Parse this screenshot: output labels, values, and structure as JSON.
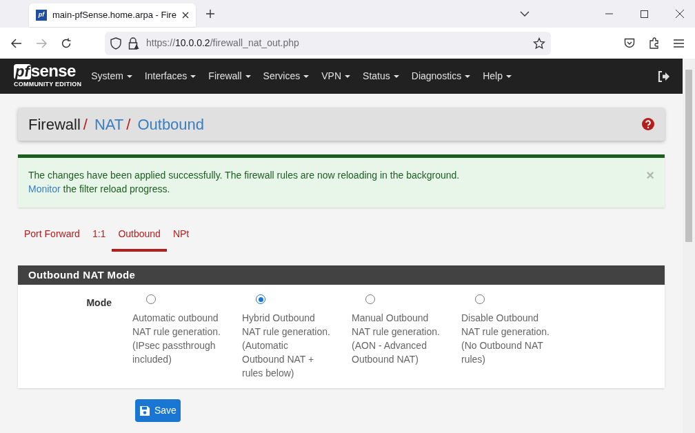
{
  "browser": {
    "favicon_text": "pf",
    "tab_title": "main-pfSense.home.arpa - Fire",
    "url": {
      "scheme": "https://",
      "host": "10.0.0.2",
      "path": "/firewall_nat_out.php"
    }
  },
  "navbar": {
    "logo": "sense",
    "logo_prefix": "pf",
    "edition": "COMMUNITY EDITION",
    "menus": [
      {
        "label": "System"
      },
      {
        "label": "Interfaces"
      },
      {
        "label": "Firewall"
      },
      {
        "label": "Services"
      },
      {
        "label": "VPN"
      },
      {
        "label": "Status"
      },
      {
        "label": "Diagnostics"
      },
      {
        "label": "Help"
      }
    ]
  },
  "breadcrumb": [
    {
      "label": "Firewall",
      "link": false,
      "separator": "/"
    },
    {
      "label": "NAT",
      "link": true,
      "separator": "/"
    },
    {
      "label": "Outbound",
      "link": true
    }
  ],
  "alert": {
    "text": "The changes have been applied successfully. The firewall rules are now reloading in the background.",
    "link": "Monitor",
    "text_after": " the filter reload progress.",
    "close": "×"
  },
  "tabs": [
    {
      "label": "Port Forward",
      "selected": false
    },
    {
      "label": "1:1",
      "selected": false
    },
    {
      "label": "Outbound",
      "selected": true
    },
    {
      "label": "NPt",
      "selected": false
    }
  ],
  "panel": {
    "title": "Outbound NAT Mode",
    "field_label": "Mode",
    "options": [
      {
        "label": "Automatic outbound NAT rule generation. (IPsec passthrough included)",
        "selected": false
      },
      {
        "label": "Hybrid Outbound NAT rule generation. (Automatic Outbound NAT + rules below)",
        "selected": true
      },
      {
        "label": "Manual Outbound NAT rule generation. (AON - Advanced Outbound NAT)",
        "selected": false
      },
      {
        "label": "Disable Outbound NAT rule generation. (No Outbound NAT rules)",
        "selected": false
      }
    ]
  },
  "save_button": "Save"
}
